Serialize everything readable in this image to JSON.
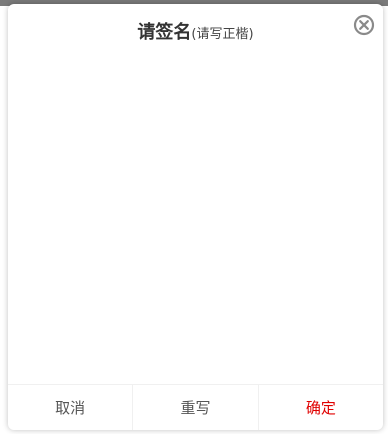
{
  "dialog": {
    "title_main": "请签名",
    "title_sub": "(请写正楷)",
    "close_icon": "close-circle-icon"
  },
  "buttons": {
    "cancel_label": "取消",
    "rewrite_label": "重写",
    "confirm_label": "确定"
  },
  "colors": {
    "confirm": "#e00000",
    "text": "#555555",
    "title": "#333333"
  }
}
